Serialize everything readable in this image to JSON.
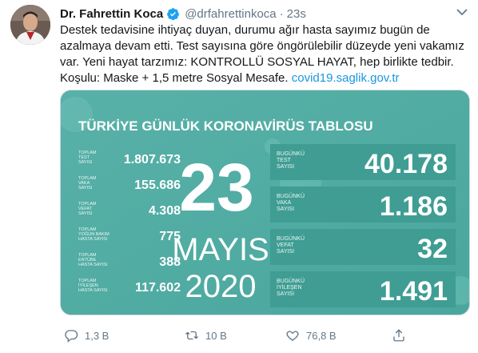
{
  "tweet": {
    "name": "Dr. Fahrettin Koca",
    "handle": "@drfahrettinkoca",
    "separator": "·",
    "time": "23s",
    "text_line1": "Destek tedavisine ihtiyaç duyan, durumu ağır hasta sayımız bugün de",
    "text_line2": "azalmaya devam etti. Test sayısına göre öngörülebilir düzeyde yeni vakamız",
    "text_line3": "var. Yeni hayat tarzımız: KONTROLLÜ SOSYAL HAYAT, hep birlikte tedbir.",
    "text_line4": "Koşulu: Maske + 1,5 metre Sosyal Mesafe.",
    "link": "covid19.saglik.gov.tr"
  },
  "infographic": {
    "title": "TÜRKİYE GÜNLÜK KORONAVİRÜS TABLOSU",
    "day": "23",
    "month": "MAYIS",
    "year": "2020",
    "totals": [
      {
        "label1": "TOPLAM",
        "label2": "TEST",
        "label3": "SAYISI",
        "value": "1.807.673"
      },
      {
        "label1": "TOPLAM",
        "label2": "VAKA",
        "label3": "SAYISI",
        "value": "155.686"
      },
      {
        "label1": "TOPLAM",
        "label2": "VEFAT",
        "label3": "SAYISI",
        "value": "4.308"
      },
      {
        "label1": "TOPLAM",
        "label2": "YOĞUN BAKIM",
        "label3": "HASTA SAYISI",
        "value": "775"
      },
      {
        "label1": "TOPLAM",
        "label2": "ENTÜBE",
        "label3": "HASTA SAYISI",
        "value": "388"
      },
      {
        "label1": "TOPLAM",
        "label2": "İYİLEŞEN",
        "label3": "HASTA SAYISI",
        "value": "117.602"
      }
    ],
    "daily": [
      {
        "label1": "BUGÜNKÜ",
        "label2": "TEST",
        "label3": "SAYISI",
        "value": "40.178"
      },
      {
        "label1": "BUGÜNKÜ",
        "label2": "VAKA",
        "label3": "SAYISI",
        "value": "1.186"
      },
      {
        "label1": "BUGÜNKÜ",
        "label2": "VEFAT",
        "label3": "SAYISI",
        "value": "32"
      },
      {
        "label1": "BUGÜNKÜ",
        "label2": "İYİLEŞEN",
        "label3": "SAYISI",
        "value": "1.491"
      }
    ],
    "colors": {
      "bg": "#5fb6ad",
      "panel": "#3f9d93",
      "light": "#e8f6f4"
    }
  },
  "actions": {
    "reply_count": "1,3 B",
    "retweet_count": "10 B",
    "like_count": "76,8 B"
  },
  "icons": [
    "verified-badge-icon",
    "caret-down-icon",
    "reply-icon",
    "retweet-icon",
    "like-icon",
    "share-icon"
  ]
}
